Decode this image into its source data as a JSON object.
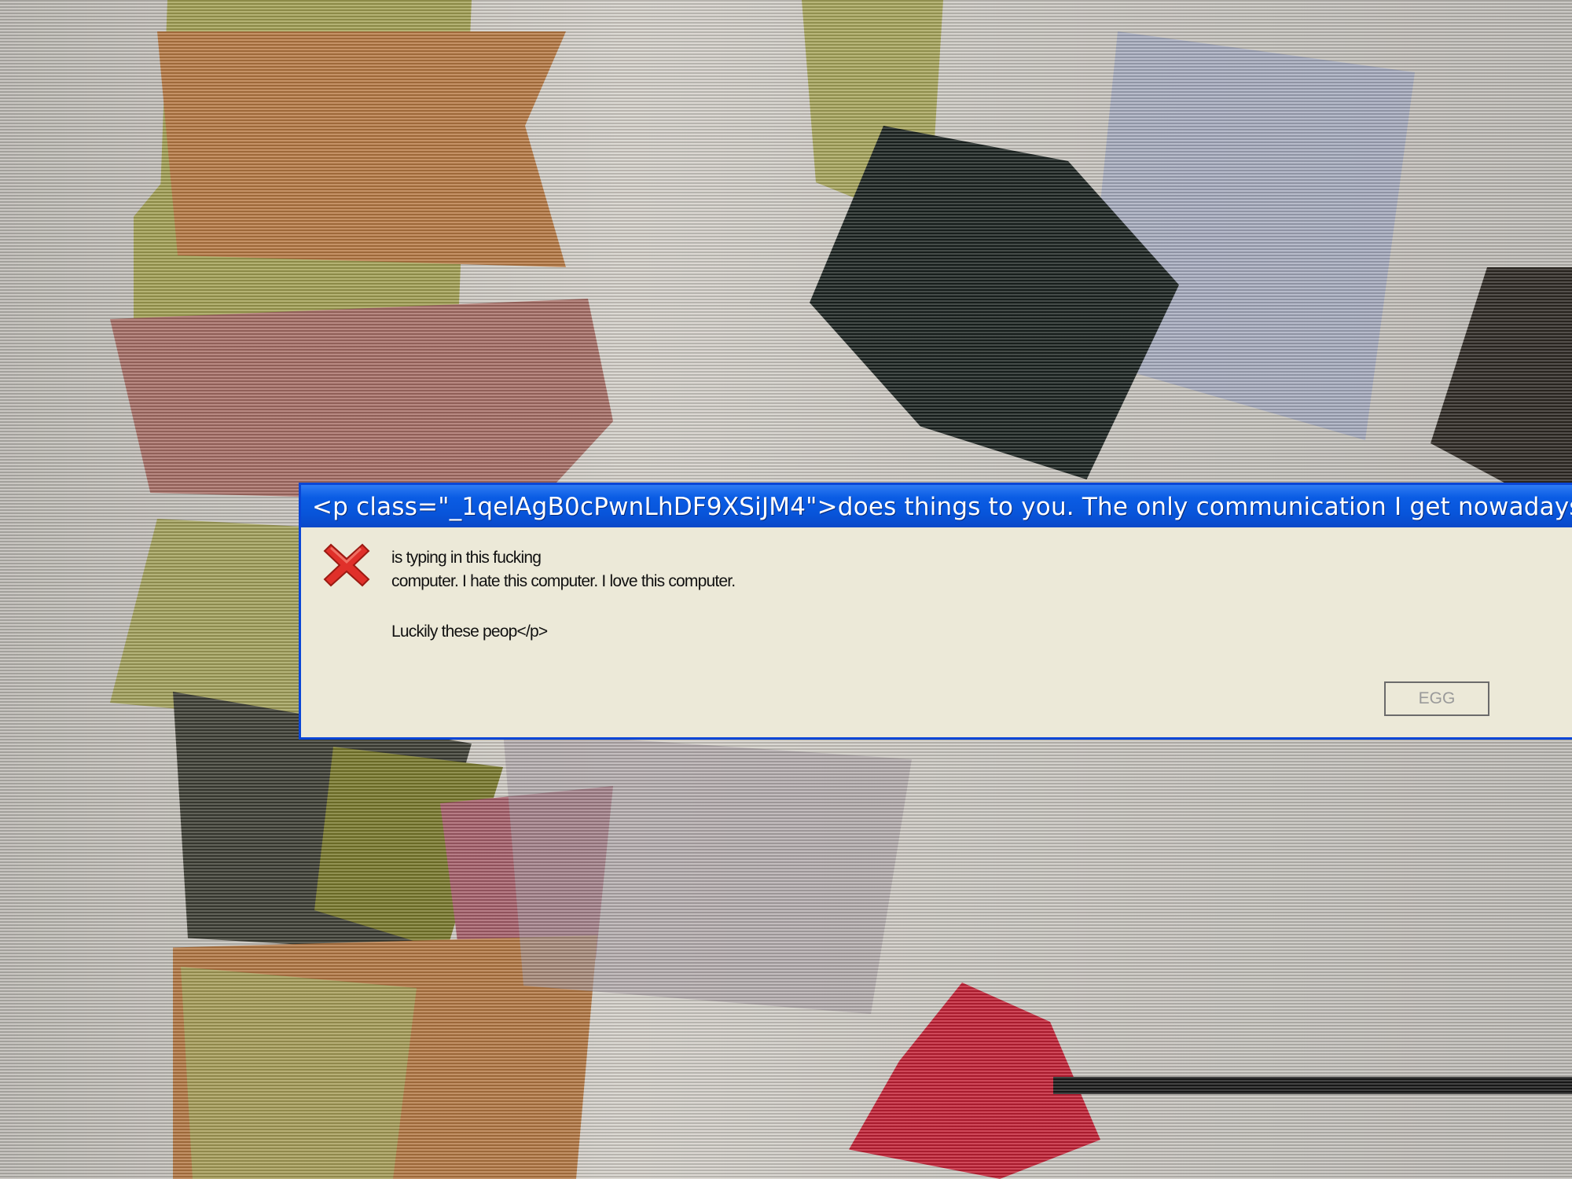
{
  "dialog": {
    "title": "<p class=\"_1qelAgB0cPwnLhDF9XSiJM4\">does things to you. The  only communication I get nowadays",
    "icon": "error-x-icon",
    "message_lines": [
      "is typing in this fucking",
      "computer. I hate this computer. I love this computer.",
      "Luckily these peop</p>"
    ],
    "button_label": "EGG"
  },
  "colors": {
    "titlebar": "#0a5ce4",
    "dialog_body": "#ece9d8",
    "error_red": "#e0302a"
  }
}
